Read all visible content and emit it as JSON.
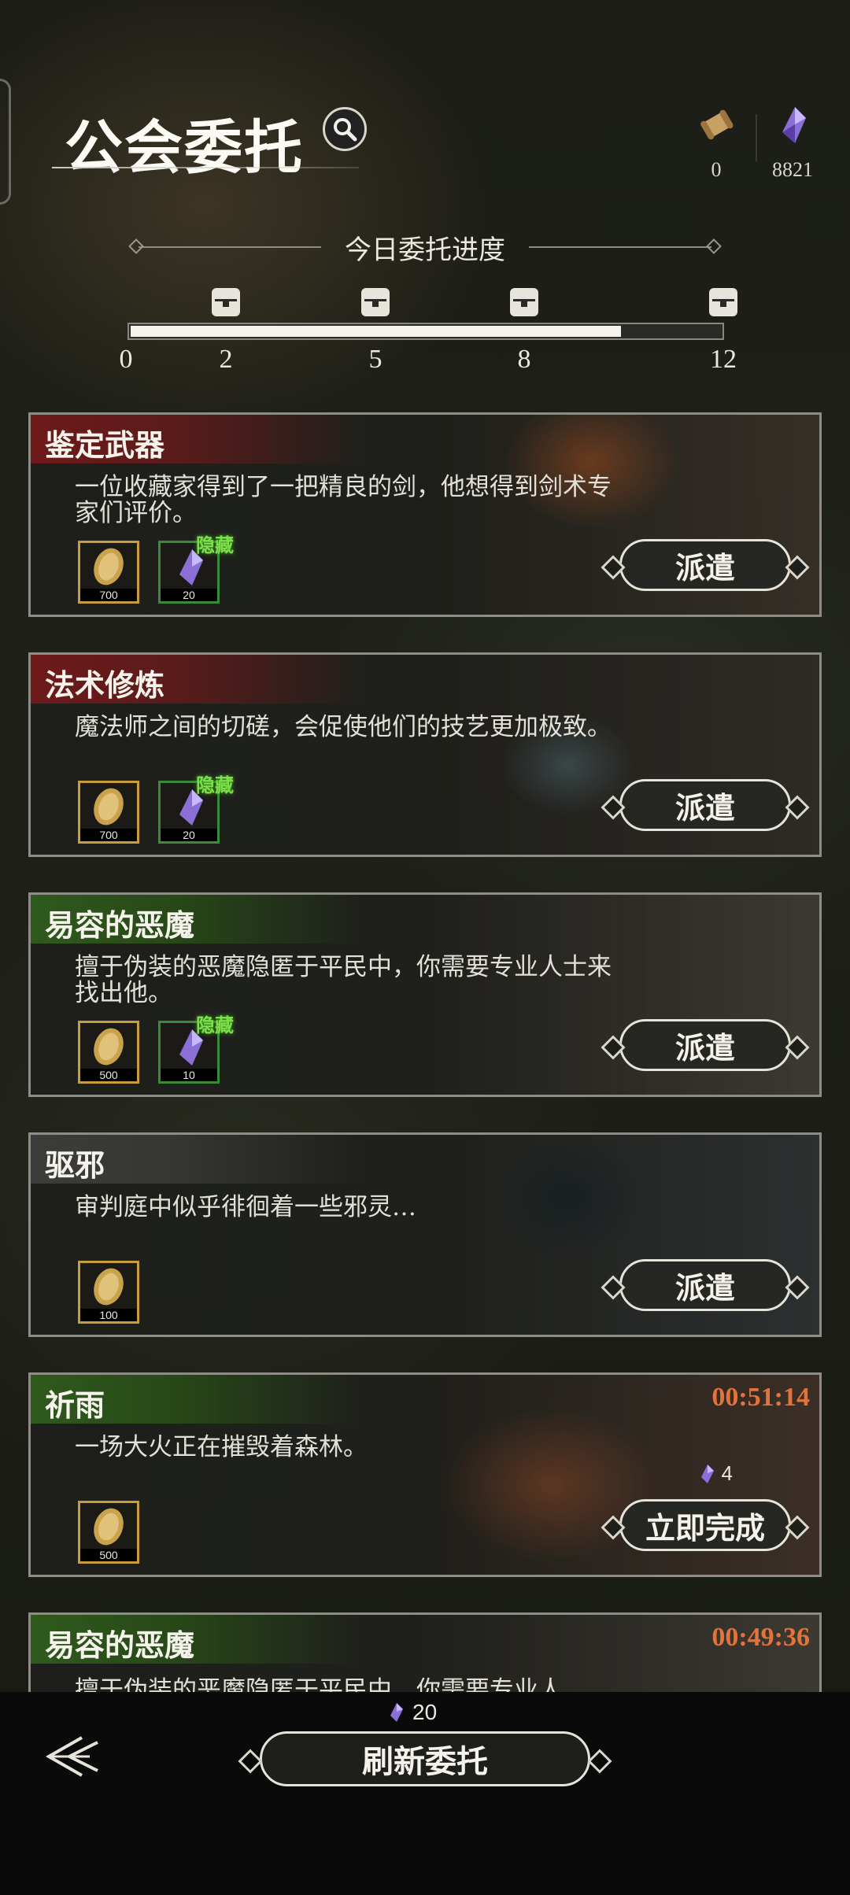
{
  "header": {
    "title": "公会委托",
    "currencies": [
      {
        "icon": "scroll-icon",
        "value": "0"
      },
      {
        "icon": "crystal-icon",
        "value": "8821"
      }
    ]
  },
  "progress": {
    "label": "今日委托进度",
    "current": 10,
    "max": 12,
    "fraction": 0.83,
    "ticks": [
      "0",
      "2",
      "5",
      "8",
      "12"
    ]
  },
  "quests": [
    {
      "name": "鉴定武器",
      "desc": "一位收藏家得到了一把精良的剑，他想得到剑术专家们评价。",
      "color": "red",
      "rewards": [
        {
          "icon": "gold-coin-icon",
          "amount": "700"
        },
        {
          "icon": "crystal-icon",
          "amount": "20",
          "tag": "隐藏"
        }
      ],
      "action": "派遣"
    },
    {
      "name": "法术修炼",
      "desc": "魔法师之间的切磋，会促使他们的技艺更加极致。",
      "color": "red",
      "rewards": [
        {
          "icon": "gold-coin-icon",
          "amount": "700"
        },
        {
          "icon": "crystal-icon",
          "amount": "20",
          "tag": "隐藏"
        }
      ],
      "action": "派遣"
    },
    {
      "name": "易容的恶魔",
      "desc": "擅于伪装的恶魔隐匿于平民中，你需要专业人士来找出他。",
      "color": "green",
      "rewards": [
        {
          "icon": "gold-coin-icon",
          "amount": "500"
        },
        {
          "icon": "crystal-icon",
          "amount": "10",
          "tag": "隐藏"
        }
      ],
      "action": "派遣"
    },
    {
      "name": "驱邪",
      "desc": "审判庭中似乎徘徊着一些邪灵…",
      "color": "grey",
      "rewards": [
        {
          "icon": "gold-coin-icon",
          "amount": "100"
        }
      ],
      "action": "派遣"
    },
    {
      "name": "祈雨",
      "desc": "一场大火正在摧毁着森林。",
      "color": "green",
      "rewards": [
        {
          "icon": "gold-coin-icon",
          "amount": "500"
        }
      ],
      "timer": "00:51:14",
      "cost": "4",
      "action": "立即完成"
    },
    {
      "name": "易容的恶魔",
      "desc": "擅于伪装的恶魔隐匿于平民中，你需要专业人",
      "color": "green",
      "timer": "00:49:36"
    }
  ],
  "footer": {
    "refresh_cost": "20",
    "refresh_label": "刷新委托"
  },
  "colors": {
    "accent_timer": "#e3733a",
    "hidden_tag": "#7dde4a",
    "gold_border": "#c79c3c"
  }
}
